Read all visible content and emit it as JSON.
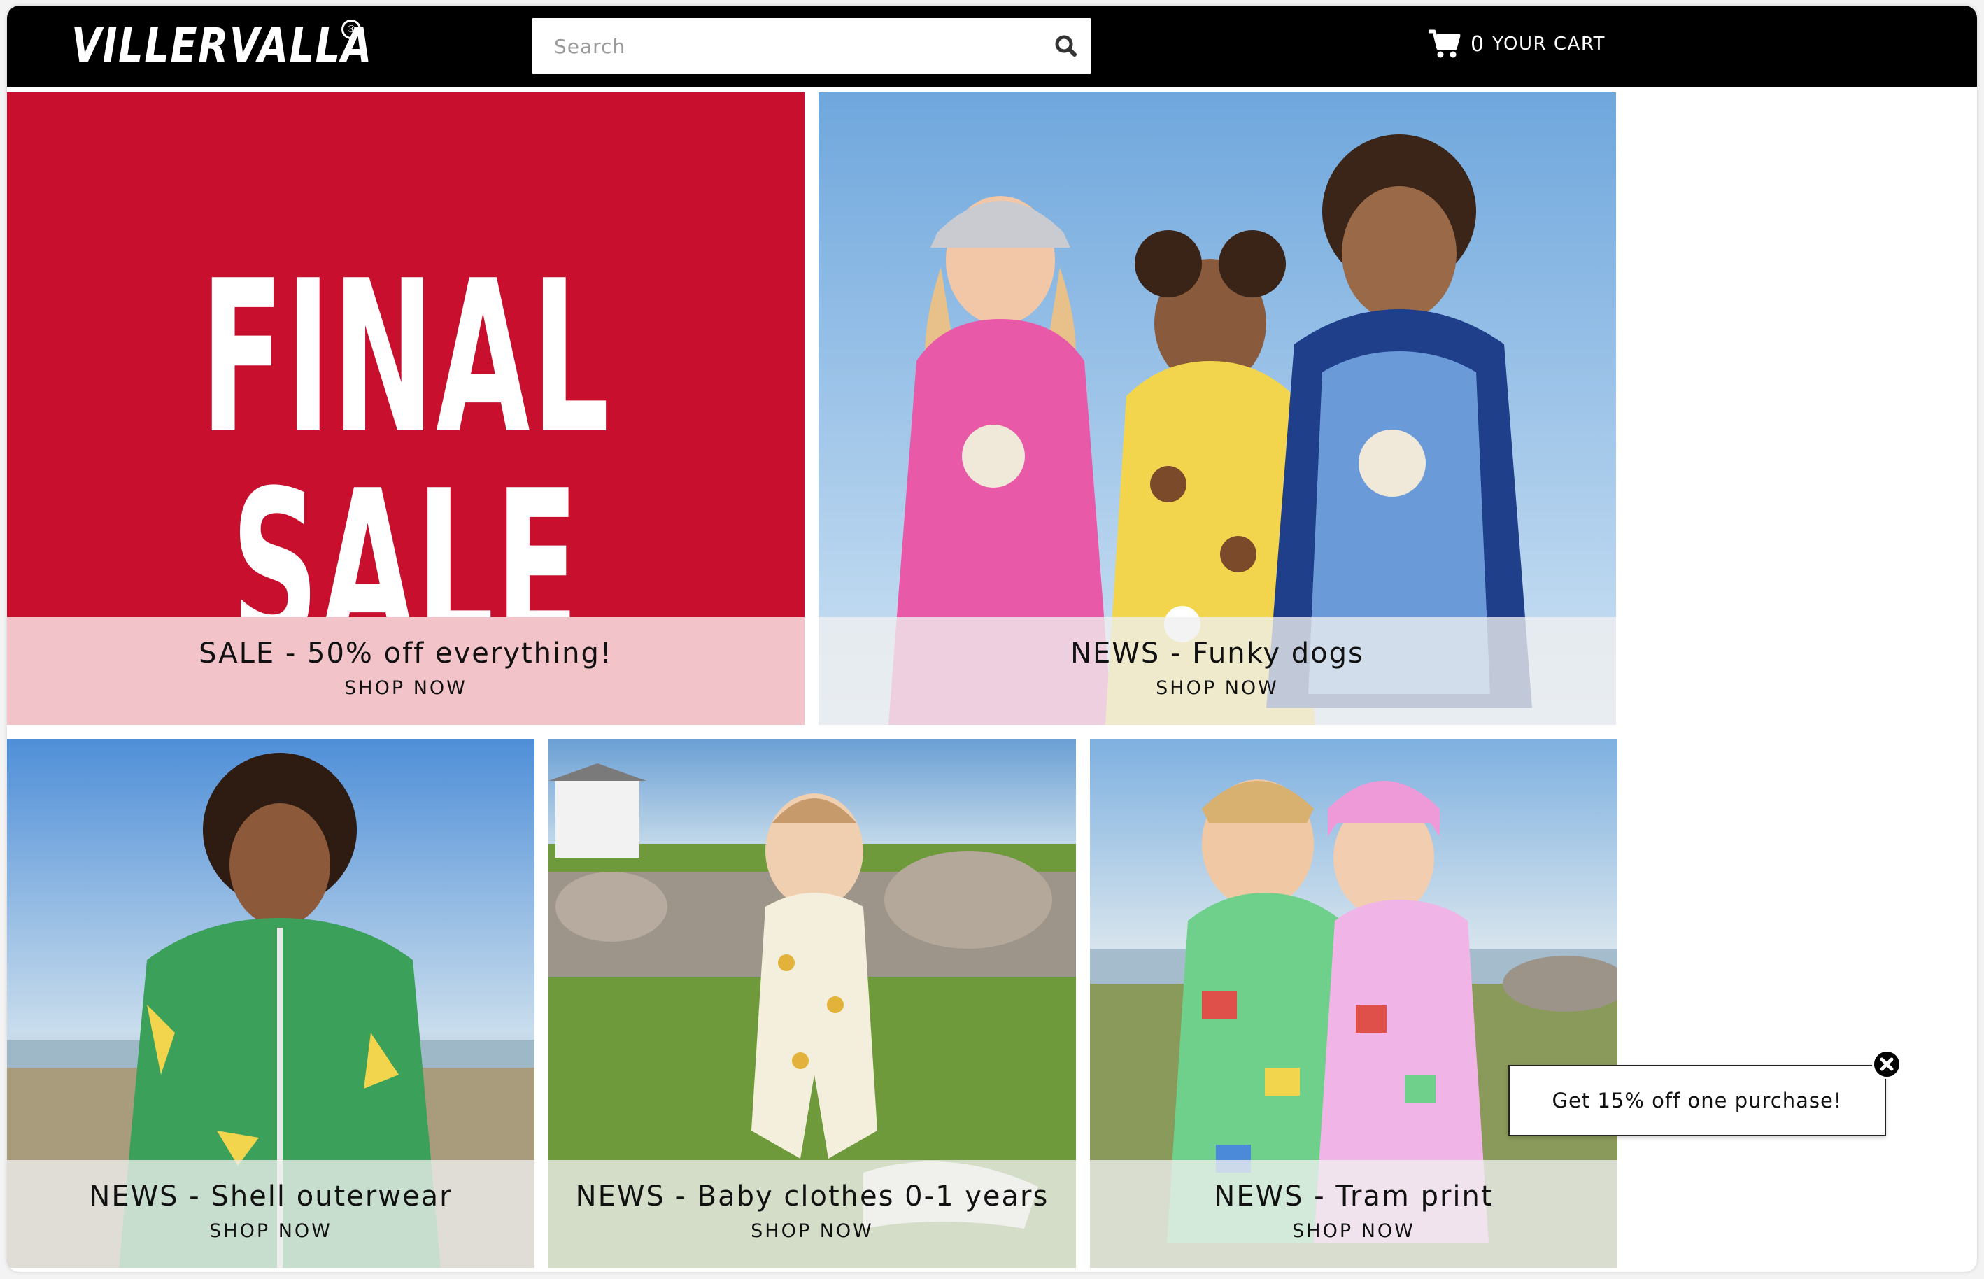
{
  "brand": {
    "logo_text": "VILLERVALLA",
    "logo_mark": "®"
  },
  "header": {
    "search_placeholder": "Search",
    "search_icon": "search-icon",
    "cart": {
      "icon": "cart-icon",
      "count": "0",
      "label": "YOUR CART"
    }
  },
  "tiles": [
    {
      "banner_text": "FINAL SALE",
      "title": "SALE - 50% off everything!",
      "cta": "SHOP NOW",
      "bg_color": "#c8102e",
      "caption_color": "#f2c4ca"
    },
    {
      "title": "NEWS - Funky dogs",
      "cta": "SHOP NOW"
    },
    {
      "title": "NEWS - Shell outerwear",
      "cta": "SHOP NOW"
    },
    {
      "title": "NEWS - Baby clothes 0-1 years",
      "cta": "SHOP NOW"
    },
    {
      "title": "NEWS - Tram print",
      "cta": "SHOP NOW"
    }
  ],
  "promo": {
    "text": "Get 15% off one purchase!",
    "close_icon": "close-icon"
  },
  "colors": {
    "header_bg": "#000000",
    "sale_red": "#c8102e",
    "sale_caption_pink": "#f2c4ca"
  }
}
